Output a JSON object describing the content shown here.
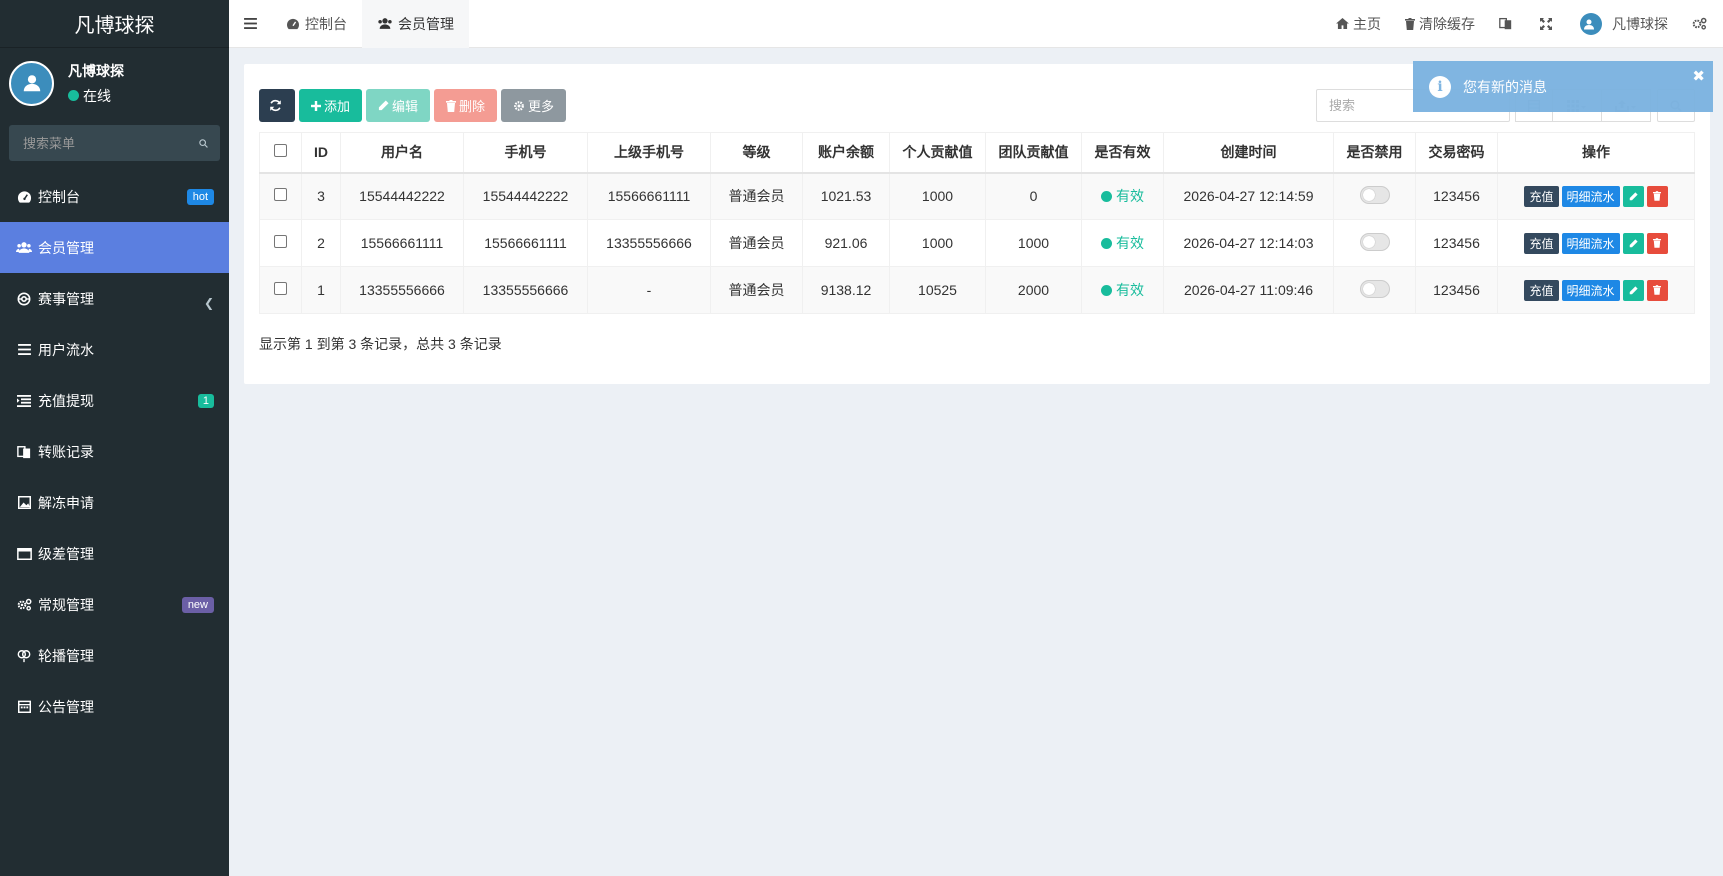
{
  "brand": "凡博球探",
  "user": {
    "name": "凡博球探",
    "status": "在线"
  },
  "sidebar_search": {
    "placeholder": "搜索菜单"
  },
  "menu": [
    {
      "label": "控制台",
      "icon": "dashboard-icon",
      "badge": "hot"
    },
    {
      "label": "会员管理",
      "icon": "users-icon",
      "active": true
    },
    {
      "label": "赛事管理",
      "icon": "globe-icon"
    },
    {
      "label": "用户流水",
      "icon": "list-icon"
    },
    {
      "label": "充值提现",
      "icon": "list-indent-icon",
      "badge": "1"
    },
    {
      "label": "转账记录",
      "icon": "exchange-icon"
    },
    {
      "label": "解冻申请",
      "icon": "image-icon"
    },
    {
      "label": "级差管理",
      "icon": "window-icon"
    },
    {
      "label": "常规管理",
      "icon": "cogs-icon",
      "badge": "new"
    },
    {
      "label": "轮播管理",
      "icon": "balloon-icon"
    },
    {
      "label": "公告管理",
      "icon": "calendar-icon"
    }
  ],
  "tabs": [
    {
      "label": "控制台"
    },
    {
      "label": "会员管理"
    }
  ],
  "topbar": {
    "home": "主页",
    "clear_cache": "清除缓存",
    "username": "凡博球探"
  },
  "toolbar": {
    "add": "添加",
    "edit": "编辑",
    "delete": "删除",
    "more": "更多"
  },
  "search": {
    "placeholder": "搜索"
  },
  "columns": [
    "ID",
    "用户名",
    "手机号",
    "上级手机号",
    "等级",
    "账户余额",
    "个人贡献值",
    "团队贡献值",
    "是否有效",
    "创建时间",
    "是否禁用",
    "交易密码",
    "操作"
  ],
  "rows": [
    {
      "id": "3",
      "username": "15544442222",
      "phone": "15544442222",
      "parent_phone": "15566661111",
      "level": "普通会员",
      "balance": "1021.53",
      "personal": "1000",
      "team": "0",
      "valid": "有效",
      "created": "2026-04-27 12:14:59",
      "pwd": "123456"
    },
    {
      "id": "2",
      "username": "15566661111",
      "phone": "15566661111",
      "parent_phone": "13355556666",
      "level": "普通会员",
      "balance": "921.06",
      "personal": "1000",
      "team": "1000",
      "valid": "有效",
      "created": "2026-04-27 12:14:03",
      "pwd": "123456"
    },
    {
      "id": "1",
      "username": "13355556666",
      "phone": "13355556666",
      "parent_phone": "-",
      "level": "普通会员",
      "balance": "9138.12",
      "personal": "10525",
      "team": "2000",
      "valid": "有效",
      "created": "2026-04-27 11:09:46",
      "pwd": "123456"
    }
  ],
  "ops": {
    "charge": "充值",
    "detail": "明细流水"
  },
  "pageinfo": "显示第 1 到第 3 条记录，总共 3 条记录",
  "toast": {
    "message": "您有新的消息"
  }
}
